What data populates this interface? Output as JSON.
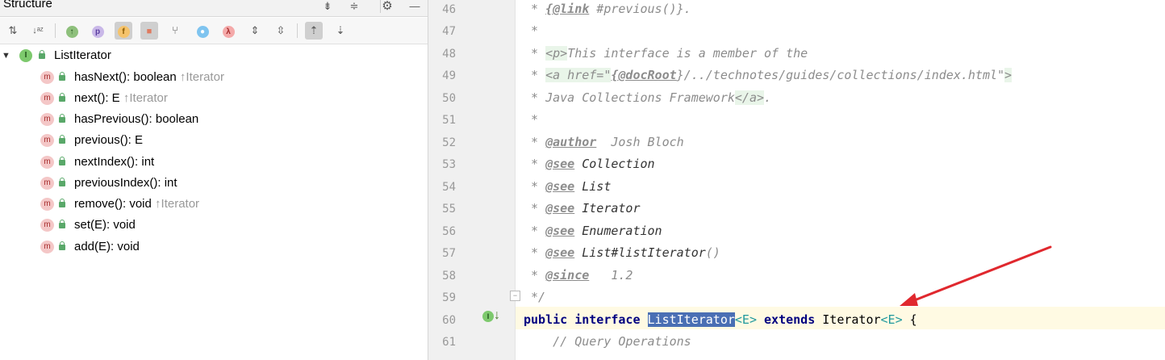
{
  "structure": {
    "title": "Structure",
    "root": {
      "label": "ListIterator"
    },
    "methods": [
      {
        "name": "hasNext(): boolean",
        "inherited": "↑Iterator"
      },
      {
        "name": "next(): E",
        "inherited": "↑Iterator"
      },
      {
        "name": "hasPrevious(): boolean",
        "inherited": ""
      },
      {
        "name": "previous(): E",
        "inherited": ""
      },
      {
        "name": "nextIndex(): int",
        "inherited": ""
      },
      {
        "name": "previousIndex(): int",
        "inherited": ""
      },
      {
        "name": "remove(): void",
        "inherited": "↑Iterator"
      },
      {
        "name": "set(E): void",
        "inherited": ""
      },
      {
        "name": "add(E): void",
        "inherited": ""
      }
    ],
    "toolbar_icons": [
      "sort-by-visibility-icon",
      "sort-alphabetically-icon",
      "show-inherited-icon",
      "show-properties-icon",
      "show-fields-icon",
      "show-non-public-icon",
      "show-anonymous-icon",
      "show-lambdas-icon",
      "lambda-icon",
      "expand-all-icon",
      "collapse-all-icon",
      "autoscroll-to-source-icon",
      "autoscroll-from-source-icon"
    ]
  },
  "editor": {
    "line_numbers": [
      "46",
      "47",
      "48",
      "49",
      "50",
      "51",
      "52",
      "53",
      "54",
      "55",
      "56",
      "57",
      "58",
      "59",
      "60",
      "61"
    ],
    "code": {
      "l46_a": " * ",
      "l46_tag": "{@link",
      "l46_b": " #previous()}.",
      "l47": " *",
      "l48_a": " * ",
      "l48_tag": "<p>",
      "l48_b": "This interface is a member of the",
      "l49_a": " * ",
      "l49_tag": "<a href=\"",
      "l49_tag2": "{@docRoot",
      "l49_b": "}/../technotes/guides/collections/index.html\"",
      "l49_tag3": ">",
      "l50_a": " * Java Collections Framework",
      "l50_tag": "</a>",
      "l50_b": ".",
      "l51": " *",
      "l52_a": " * ",
      "l52_tag": "@author",
      "l52_b": "  Josh Bloch",
      "l53_a": " * ",
      "l53_tag": "@see",
      "l53_b": " Collection",
      "l54_a": " * ",
      "l54_tag": "@see",
      "l54_b": " List",
      "l55_a": " * ",
      "l55_tag": "@see",
      "l55_b": " Iterator",
      "l56_a": " * ",
      "l56_tag": "@see",
      "l56_b": " Enumeration",
      "l57_a": " * ",
      "l57_tag": "@see",
      "l57_b": " List#listIterator",
      "l57_c": "()",
      "l58_a": " * ",
      "l58_tag": "@since",
      "l58_b": "   1.2",
      "l59": " */",
      "l60_kw1": "public interface ",
      "l60_sel": "ListIterator",
      "l60_t1": "<E>",
      "l60_kw2": " extends ",
      "l60_b": "Iterator",
      "l60_t2": "<E>",
      "l60_c": " {",
      "l61": "    // Query Operations"
    }
  },
  "colors": {
    "arrow": "#e0282e",
    "selection": "#4a6fb4",
    "current_line": "#fffae3",
    "interface_icon": "#7dc96d"
  }
}
